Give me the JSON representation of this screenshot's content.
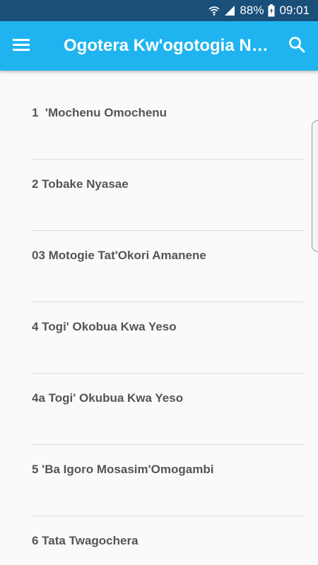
{
  "status_bar": {
    "battery": "88%",
    "time": "09:01",
    "icons": [
      "wifi-icon",
      "signal-icon",
      "battery-icon"
    ]
  },
  "app_bar": {
    "title": "Ogotera Kw'ogotogia Ny…",
    "menu_icon": "menu-icon",
    "search_icon": "search-icon",
    "background": "#1fb4f0"
  },
  "list": {
    "items": [
      {
        "label": "1  'Mochenu Omochenu"
      },
      {
        "label": "2 Tobake Nyasae"
      },
      {
        "label": "03 Motogie Tat'Okori Amanene"
      },
      {
        "label": "4 Togi' Okobua Kwa Yeso"
      },
      {
        "label": "4a Togi' Okubua Kwa Yeso"
      },
      {
        "label": "5 'Ba Igoro Mosasim'Omogambi"
      },
      {
        "label": "6 Tata Twagochera"
      }
    ]
  }
}
